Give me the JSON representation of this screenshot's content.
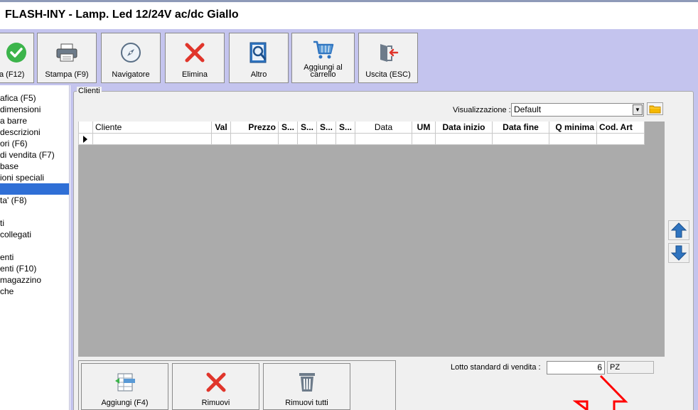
{
  "window": {
    "title": "FLASH-INY - Lamp. Led 12/24V ac/dc Giallo"
  },
  "toolbar": {
    "buttons": [
      {
        "label": "a (F12)",
        "icon": "check-icon"
      },
      {
        "label": "Stampa (F9)",
        "icon": "printer-icon"
      },
      {
        "label": "Navigatore",
        "icon": "compass-icon"
      },
      {
        "label": "Elimina",
        "icon": "delete-x-icon"
      },
      {
        "label": "Altro",
        "icon": "search-document-icon"
      },
      {
        "label": "Aggiungi al",
        "label2": "carrello",
        "icon": "cart-icon"
      },
      {
        "label": "Uscita (ESC)",
        "icon": "exit-door-icon"
      }
    ]
  },
  "sidebar": {
    "items": [
      {
        "label": "afica (F5)"
      },
      {
        "label": " dimensioni"
      },
      {
        "label": "a barre"
      },
      {
        "label": " descrizioni"
      },
      {
        "label": "ori (F6)"
      },
      {
        "label": "di vendita (F7)"
      },
      {
        "label": "base"
      },
      {
        "label": "ioni speciali"
      },
      {
        "label": ""
      },
      {
        "label": "ta' (F8)"
      },
      {
        "label": ""
      },
      {
        "label": "ti"
      },
      {
        "label": " collegati"
      },
      {
        "label": ""
      },
      {
        "label": "enti"
      },
      {
        "label": "enti (F10)"
      },
      {
        "label": " magazzino"
      },
      {
        "label": "che"
      }
    ],
    "selected_index": 8
  },
  "clienti": {
    "group_label": "Clienti",
    "visualizzazione_label": "Visualizzazione :",
    "visualizzazione_value": "Default",
    "columns": [
      "Cliente",
      "Val",
      "Prezzo",
      "S...",
      "S...",
      "S...",
      "S...",
      "Data",
      "UM",
      "Data inizio",
      "Data fine",
      "Q minima",
      "Cod. Art"
    ]
  },
  "bottom": {
    "add_label": "Aggiungi (F4)",
    "remove_label": "Rimuovi",
    "remove_all_label": "Rimuovi tutti",
    "lotto_label": "Lotto standard di vendita :",
    "lotto_value": "6",
    "um_value": "PZ"
  },
  "colors": {
    "toolbar_bg": "#c4c4ee",
    "selection": "#2f6fd6",
    "delete_red": "#e0352b",
    "arrow_blue": "#2f74c0",
    "annotation_red": "#ff0000"
  }
}
